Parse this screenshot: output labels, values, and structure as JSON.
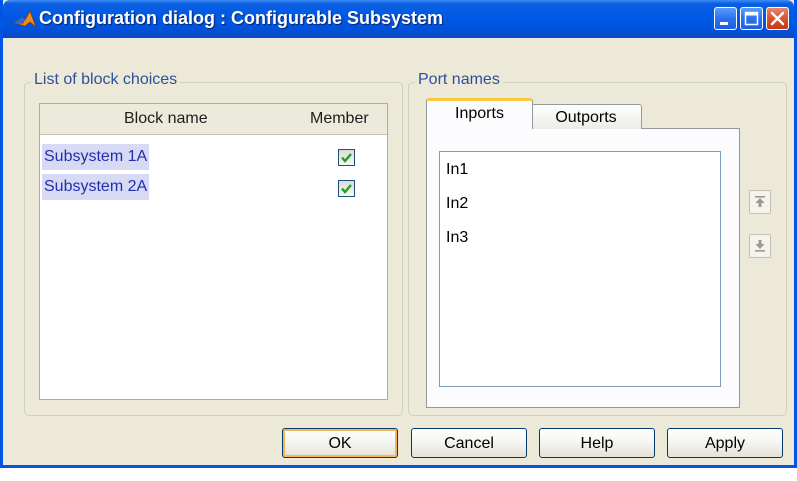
{
  "window": {
    "title": "Configuration dialog : Configurable Subsystem"
  },
  "block_choices": {
    "group_title": "List of block choices",
    "columns": [
      "Block name",
      "Member"
    ],
    "rows": [
      {
        "name": "Subsystem 1A",
        "member": true
      },
      {
        "name": "Subsystem 2A",
        "member": true
      }
    ]
  },
  "port_names": {
    "group_title": "Port names",
    "tabs": [
      "Inports",
      "Outports"
    ],
    "active_tab": "Inports",
    "items": [
      "In1",
      "In2",
      "In3"
    ]
  },
  "buttons": {
    "ok": "OK",
    "cancel": "Cancel",
    "help": "Help",
    "apply": "Apply"
  },
  "colors": {
    "title_bar": "#0058e6",
    "selection_bg": "#d8daf5",
    "selection_text": "#1f2fb0",
    "check_mark": "#21a121",
    "group_title_text": "#2f4f9c",
    "active_tab_accent": "#ffc83c"
  }
}
